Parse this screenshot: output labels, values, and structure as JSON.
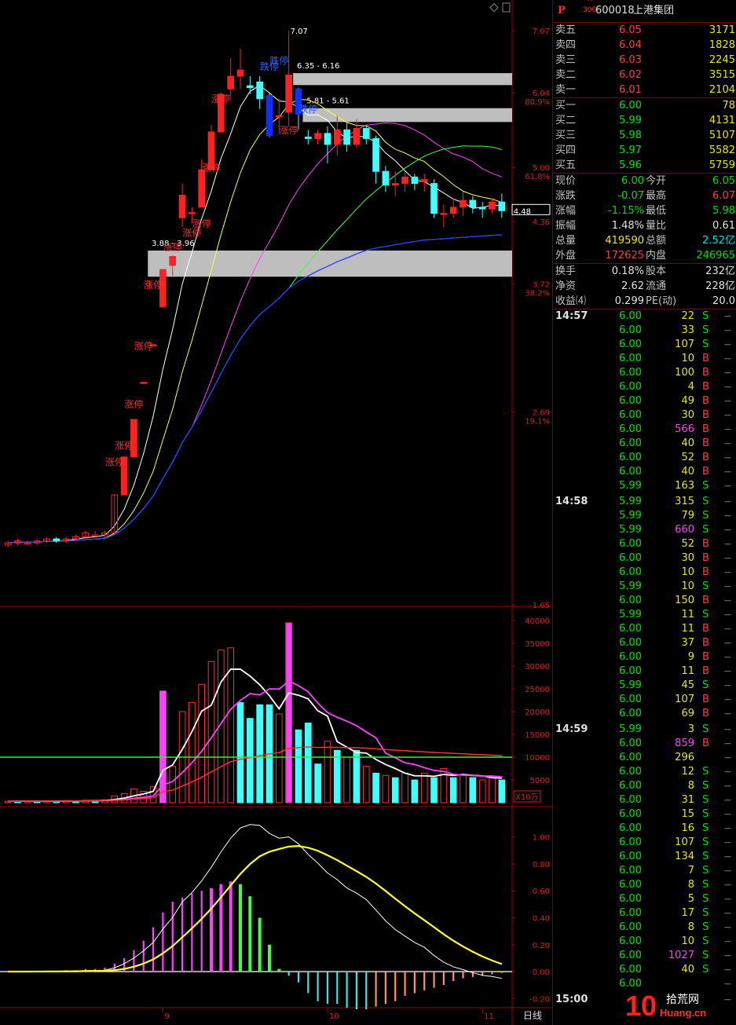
{
  "stock": {
    "market_mark": "P",
    "badge_r": "R",
    "badge_num": "300",
    "code": "600018",
    "name": "上港集团"
  },
  "asks": [
    {
      "label": "卖五",
      "price": "6.05",
      "vol": "3171"
    },
    {
      "label": "卖四",
      "price": "6.04",
      "vol": "1828"
    },
    {
      "label": "卖三",
      "price": "6.03",
      "vol": "2245"
    },
    {
      "label": "卖二",
      "price": "6.02",
      "vol": "3515"
    },
    {
      "label": "卖一",
      "price": "6.01",
      "vol": "2104"
    }
  ],
  "bids": [
    {
      "label": "买一",
      "price": "6.00",
      "vol": "78"
    },
    {
      "label": "买二",
      "price": "5.99",
      "vol": "4131"
    },
    {
      "label": "买三",
      "price": "5.98",
      "vol": "5107"
    },
    {
      "label": "买四",
      "price": "5.97",
      "vol": "5582"
    },
    {
      "label": "买五",
      "price": "5.96",
      "vol": "5759"
    }
  ],
  "quote": [
    {
      "l1": "现价",
      "v1": "6.00",
      "l2": "今开",
      "v2": "6.05"
    },
    {
      "l1": "涨跌",
      "v1": "-0.07",
      "l2": "最高",
      "v2": "6.07"
    },
    {
      "l1": "涨幅",
      "v1": "-1.15%",
      "l2": "最低",
      "v2": "5.98"
    },
    {
      "l1": "振幅",
      "v1": "1.48%",
      "l2": "量比",
      "v2": "0.61"
    },
    {
      "l1": "总量",
      "v1": "419590",
      "l2": "总额",
      "v2": "2.52亿"
    },
    {
      "l1": "外盘",
      "v1": "172625",
      "l2": "内盘",
      "v2": "246965"
    }
  ],
  "fundamentals": [
    {
      "l1": "换手",
      "v1": "0.18%",
      "l2": "股本",
      "v2": "232亿"
    },
    {
      "l1": "净资",
      "v1": "2.62",
      "l2": "流通",
      "v2": "228亿"
    },
    {
      "l1": "收益⑷",
      "v1": "0.299",
      "l2": "PE(动)",
      "v2": "20.0"
    }
  ],
  "ticks": [
    {
      "time": "14:57",
      "price": "6.00",
      "vol": "22",
      "side": "S"
    },
    {
      "time": "",
      "price": "6.00",
      "vol": "33",
      "side": "S"
    },
    {
      "time": "",
      "price": "6.00",
      "vol": "107",
      "side": "S"
    },
    {
      "time": "",
      "price": "6.00",
      "vol": "10",
      "side": "B"
    },
    {
      "time": "",
      "price": "6.00",
      "vol": "100",
      "side": "B"
    },
    {
      "time": "",
      "price": "6.00",
      "vol": "4",
      "side": "B"
    },
    {
      "time": "",
      "price": "6.00",
      "vol": "49",
      "side": "B"
    },
    {
      "time": "",
      "price": "6.00",
      "vol": "30",
      "side": "B"
    },
    {
      "time": "",
      "price": "6.00",
      "vol": "566",
      "side": "B"
    },
    {
      "time": "",
      "price": "6.00",
      "vol": "40",
      "side": "B"
    },
    {
      "time": "",
      "price": "6.00",
      "vol": "52",
      "side": "B"
    },
    {
      "time": "",
      "price": "6.00",
      "vol": "40",
      "side": "B"
    },
    {
      "time": "",
      "price": "5.99",
      "vol": "163",
      "side": "S"
    },
    {
      "time": "14:58",
      "price": "5.99",
      "vol": "315",
      "side": "S"
    },
    {
      "time": "",
      "price": "5.99",
      "vol": "79",
      "side": "S"
    },
    {
      "time": "",
      "price": "5.99",
      "vol": "660",
      "side": "S"
    },
    {
      "time": "",
      "price": "6.00",
      "vol": "52",
      "side": "B"
    },
    {
      "time": "",
      "price": "6.00",
      "vol": "30",
      "side": "B"
    },
    {
      "time": "",
      "price": "6.00",
      "vol": "10",
      "side": "B"
    },
    {
      "time": "",
      "price": "5.99",
      "vol": "10",
      "side": "S"
    },
    {
      "time": "",
      "price": "6.00",
      "vol": "150",
      "side": "B"
    },
    {
      "time": "",
      "price": "5.99",
      "vol": "11",
      "side": "S"
    },
    {
      "time": "",
      "price": "6.00",
      "vol": "11",
      "side": "B"
    },
    {
      "time": "",
      "price": "6.00",
      "vol": "37",
      "side": "B"
    },
    {
      "time": "",
      "price": "6.00",
      "vol": "9",
      "side": "B"
    },
    {
      "time": "",
      "price": "6.00",
      "vol": "11",
      "side": "B"
    },
    {
      "time": "",
      "price": "5.99",
      "vol": "45",
      "side": "S"
    },
    {
      "time": "",
      "price": "6.00",
      "vol": "107",
      "side": "B"
    },
    {
      "time": "",
      "price": "6.00",
      "vol": "69",
      "side": "B"
    },
    {
      "time": "14:59",
      "price": "5.99",
      "vol": "3",
      "side": "S"
    },
    {
      "time": "",
      "price": "6.00",
      "vol": "859",
      "side": "B"
    },
    {
      "time": "",
      "price": "6.00",
      "vol": "296",
      "side": ""
    },
    {
      "time": "",
      "price": "6.00",
      "vol": "12",
      "side": "S"
    },
    {
      "time": "",
      "price": "6.00",
      "vol": "8",
      "side": "S"
    },
    {
      "time": "",
      "price": "6.00",
      "vol": "31",
      "side": "S"
    },
    {
      "time": "",
      "price": "6.00",
      "vol": "15",
      "side": "S"
    },
    {
      "time": "",
      "price": "6.00",
      "vol": "16",
      "side": "S"
    },
    {
      "time": "",
      "price": "6.00",
      "vol": "107",
      "side": "S"
    },
    {
      "time": "",
      "price": "6.00",
      "vol": "134",
      "side": "S"
    },
    {
      "time": "",
      "price": "6.00",
      "vol": "7",
      "side": "S"
    },
    {
      "time": "",
      "price": "6.00",
      "vol": "8",
      "side": "S"
    },
    {
      "time": "",
      "price": "6.00",
      "vol": "5",
      "side": "S"
    },
    {
      "time": "",
      "price": "6.00",
      "vol": "17",
      "side": "S"
    },
    {
      "time": "",
      "price": "6.00",
      "vol": "8",
      "side": "S"
    },
    {
      "time": "",
      "price": "6.00",
      "vol": "10",
      "side": "S"
    },
    {
      "time": "",
      "price": "6.00",
      "vol": "1027",
      "side": "S"
    },
    {
      "time": "",
      "price": "6.00",
      "vol": "40",
      "side": "S"
    },
    {
      "time": "",
      "price": "6.00",
      "vol": "",
      "side": ""
    },
    {
      "time": "15:00",
      "price": "",
      "vol": "",
      "side": ""
    }
  ],
  "watermark": {
    "digit": "10",
    "cn": "拾荒网",
    "url": "Huang.cn"
  },
  "chart_data": {
    "type": "candlestick",
    "price_axis_ticks": [
      {
        "label": "7.07",
        "value": 7.07
      },
      {
        "label": "6.04",
        "pct": "80.9%",
        "value": 6.04
      },
      {
        "label": "5.00",
        "pct": "61.8%",
        "value": 5.0
      },
      {
        "label": "4.48",
        "value": 4.48,
        "boxed": true
      },
      {
        "label": "4.36",
        "value": 4.36
      },
      {
        "label": "3.72",
        "pct": "38.2%",
        "value": 3.72
      },
      {
        "label": "2.69",
        "pct": "19.1%",
        "value": 2.69
      },
      {
        "label": "1.65",
        "value": 1.65
      }
    ],
    "price_range": [
      1.65,
      7.2
    ],
    "volume_axis_ticks": [
      "40000",
      "35000",
      "30000",
      "25000",
      "20000",
      "15000",
      "10000",
      "5000"
    ],
    "volume_unit": "X10万",
    "volume_range": [
      0,
      40000
    ],
    "volume_ref_line": 10000,
    "macd_axis_ticks": [
      "1.00",
      "0.80",
      "0.60",
      "0.40",
      "0.20",
      "0.00",
      "-0.20"
    ],
    "macd_range": [
      -0.28,
      1.15
    ],
    "x_labels": [
      {
        "label": "9",
        "i": 16
      },
      {
        "label": "10",
        "i": 33
      },
      {
        "label": "11",
        "i": 49
      }
    ],
    "period_label": "日线",
    "zones": [
      {
        "label": "6.35 - 6.16",
        "hi": 6.35,
        "lo": 6.16,
        "start": 30
      },
      {
        "label": "5.81 - 5.61",
        "hi": 5.81,
        "lo": 5.61,
        "start": 31
      },
      {
        "label": "3.88 - 3.96",
        "hi": 4.05,
        "lo": 3.79,
        "start": 15
      }
    ],
    "high_mark": {
      "label": "7.07",
      "i": 29
    },
    "annotations": [
      {
        "text": "涨停",
        "i": 11,
        "price": 2.35
      },
      {
        "text": "涨停",
        "i": 12,
        "price": 2.45
      },
      {
        "text": "涨停",
        "i": 13,
        "price": 2.72
      },
      {
        "text": "涨停",
        "i": 14,
        "price": 3.15
      },
      {
        "text": "涨停",
        "i": 15,
        "price": 3.68
      },
      {
        "text": "涨停",
        "i": 17,
        "price": 4.05
      },
      {
        "text": "涨停",
        "i": 19,
        "price": 4.2
      },
      {
        "text": "涨停",
        "i": 20,
        "price": 4.3
      },
      {
        "text": "涨停",
        "i": 21,
        "price": 4.95
      },
      {
        "text": "涨停",
        "i": 22,
        "price": 5.9
      },
      {
        "text": "跌停",
        "i": 27,
        "price": 6.4
      },
      {
        "text": "涨停",
        "i": 29,
        "price": 5.45
      },
      {
        "text": "跌停",
        "i": 28,
        "price": 6.5
      },
      {
        "text": "跌停",
        "i": 31,
        "price": 5.75
      }
    ],
    "candles": [
      [
        1.92,
        1.93,
        1.91,
        1.94
      ],
      [
        1.93,
        1.94,
        1.92,
        1.95
      ],
      [
        1.93,
        1.93,
        1.92,
        1.94
      ],
      [
        1.93,
        1.94,
        1.92,
        1.95
      ],
      [
        1.94,
        1.95,
        1.93,
        1.96
      ],
      [
        1.95,
        1.94,
        1.93,
        1.96
      ],
      [
        1.94,
        1.95,
        1.93,
        1.96
      ],
      [
        1.95,
        1.96,
        1.94,
        1.97
      ],
      [
        1.96,
        1.98,
        1.95,
        1.99
      ],
      [
        1.97,
        1.97,
        1.96,
        1.99
      ],
      [
        1.97,
        1.98,
        1.96,
        1.99
      ],
      [
        1.98,
        2.18,
        1.98,
        2.18
      ],
      [
        2.18,
        2.4,
        2.18,
        2.4
      ],
      [
        2.4,
        2.64,
        2.4,
        2.64
      ],
      [
        2.9,
        2.9,
        2.9,
        2.9
      ],
      [
        3.19,
        3.19,
        3.19,
        3.19
      ],
      [
        3.51,
        3.86,
        3.51,
        3.86
      ],
      [
        3.9,
        3.99,
        3.8,
        4.0
      ],
      [
        4.4,
        4.66,
        4.3,
        4.8
      ],
      [
        4.45,
        4.46,
        4.34,
        4.52
      ],
      [
        4.52,
        4.97,
        4.52,
        5.1
      ],
      [
        4.97,
        5.47,
        4.97,
        5.57
      ],
      [
        5.47,
        6.02,
        5.47,
        6.05
      ],
      [
        6.1,
        6.3,
        5.95,
        6.6
      ],
      [
        6.3,
        6.4,
        6.1,
        6.75
      ],
      [
        6.15,
        6.12,
        6.02,
        6.3
      ],
      [
        6.21,
        5.95,
        5.8,
        6.3
      ],
      [
        6.0,
        5.42,
        5.4,
        6.05
      ],
      [
        5.7,
        5.7,
        5.45,
        5.95
      ],
      [
        5.75,
        6.32,
        5.55,
        7.07
      ],
      [
        6.1,
        5.72,
        5.5,
        6.12
      ],
      [
        5.4,
        5.38,
        5.3,
        5.5
      ],
      [
        5.38,
        5.45,
        5.3,
        5.5
      ],
      [
        5.45,
        5.3,
        5.05,
        5.55
      ],
      [
        5.3,
        5.5,
        5.15,
        5.7
      ],
      [
        5.5,
        5.3,
        5.2,
        5.6
      ],
      [
        5.3,
        5.52,
        5.25,
        5.65
      ],
      [
        5.52,
        5.38,
        5.3,
        5.55
      ],
      [
        5.38,
        4.95,
        4.8,
        5.42
      ],
      [
        4.95,
        4.78,
        4.7,
        5.02
      ],
      [
        4.78,
        4.8,
        4.65,
        4.95
      ],
      [
        4.8,
        4.88,
        4.7,
        4.95
      ],
      [
        4.88,
        4.8,
        4.72,
        4.92
      ],
      [
        4.82,
        4.85,
        4.7,
        4.92
      ],
      [
        4.8,
        4.45,
        4.4,
        4.85
      ],
      [
        4.45,
        4.45,
        4.3,
        4.55
      ],
      [
        4.45,
        4.52,
        4.4,
        4.62
      ],
      [
        4.52,
        4.6,
        4.42,
        4.7
      ],
      [
        4.6,
        4.52,
        4.45,
        4.65
      ],
      [
        4.52,
        4.5,
        4.4,
        4.58
      ],
      [
        4.5,
        4.58,
        4.45,
        4.62
      ],
      [
        4.58,
        4.48,
        4.4,
        4.68
      ]
    ],
    "volumes": [
      [
        300,
        1
      ],
      [
        350,
        0
      ],
      [
        400,
        1
      ],
      [
        300,
        0
      ],
      [
        350,
        1
      ],
      [
        400,
        0
      ],
      [
        450,
        1
      ],
      [
        350,
        0
      ],
      [
        500,
        1
      ],
      [
        450,
        0
      ],
      [
        600,
        1
      ],
      [
        1500,
        1
      ],
      [
        2000,
        1
      ],
      [
        3000,
        1
      ],
      [
        2500,
        1
      ],
      [
        3500,
        1
      ],
      [
        24500,
        0
      ],
      [
        8000,
        1
      ],
      [
        20000,
        1
      ],
      [
        22000,
        1
      ],
      [
        26000,
        1
      ],
      [
        31000,
        1
      ],
      [
        33500,
        1
      ],
      [
        34000,
        1
      ],
      [
        22000,
        0
      ],
      [
        18500,
        0
      ],
      [
        21500,
        0
      ],
      [
        21500,
        0
      ],
      [
        19500,
        1
      ],
      [
        39500,
        1
      ],
      [
        16000,
        0
      ],
      [
        17500,
        0
      ],
      [
        8500,
        0
      ],
      [
        13500,
        1
      ],
      [
        11500,
        0
      ],
      [
        10000,
        1
      ],
      [
        11500,
        0
      ],
      [
        8000,
        1
      ],
      [
        6500,
        0
      ],
      [
        6000,
        1
      ],
      [
        5500,
        0
      ],
      [
        6500,
        1
      ],
      [
        5000,
        0
      ],
      [
        6500,
        1
      ],
      [
        5500,
        0
      ],
      [
        7500,
        1
      ],
      [
        5500,
        0
      ],
      [
        6000,
        1
      ],
      [
        5500,
        0
      ],
      [
        5000,
        1
      ],
      [
        5500,
        1
      ],
      [
        5000,
        0
      ]
    ],
    "macd_hist": [
      0.0,
      0.0,
      0.0,
      0.0,
      0.0,
      0.0,
      0.01,
      0.01,
      0.02,
      0.02,
      0.03,
      0.06,
      0.1,
      0.16,
      0.23,
      0.33,
      0.44,
      0.52,
      0.55,
      0.58,
      0.6,
      0.62,
      0.65,
      0.67,
      0.65,
      0.56,
      0.4,
      0.2,
      0.02,
      -0.03,
      -0.08,
      -0.16,
      -0.22,
      -0.24,
      -0.24,
      -0.27,
      -0.28,
      -0.28,
      -0.26,
      -0.24,
      -0.22,
      -0.18,
      -0.16,
      -0.14,
      -0.12,
      -0.1,
      -0.07,
      -0.05,
      -0.04,
      -0.03,
      -0.02,
      -0.01
    ]
  }
}
